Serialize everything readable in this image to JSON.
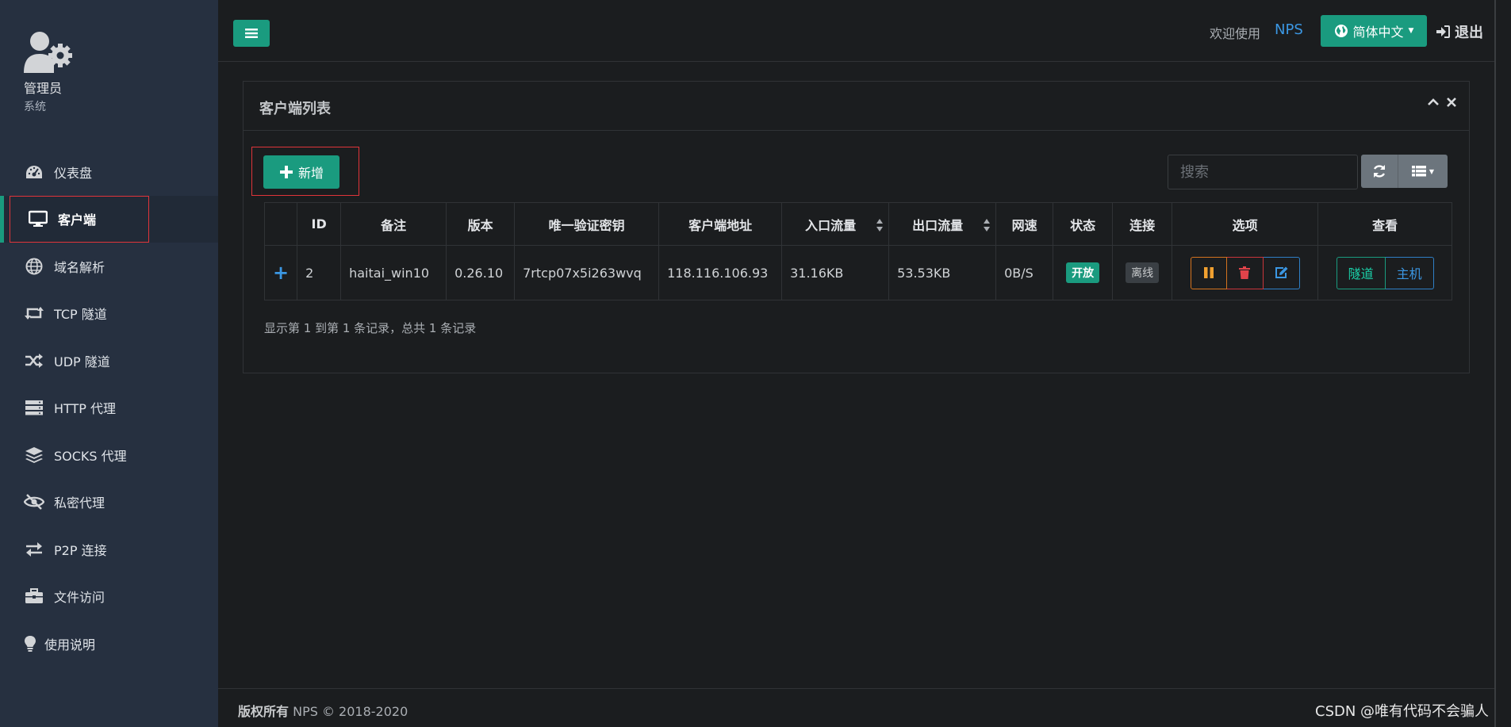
{
  "sidebar": {
    "user_name": "管理员",
    "user_role": "系统",
    "items": [
      {
        "label": "仪表盘",
        "icon": "dashboard-icon"
      },
      {
        "label": "客户端",
        "icon": "monitor-icon",
        "active": true
      },
      {
        "label": "域名解析",
        "icon": "globe-icon"
      },
      {
        "label": "TCP 隧道",
        "icon": "retweet-icon"
      },
      {
        "label": "UDP 隧道",
        "icon": "shuffle-icon"
      },
      {
        "label": "HTTP 代理",
        "icon": "server-icon"
      },
      {
        "label": "SOCKS 代理",
        "icon": "layers-icon"
      },
      {
        "label": "私密代理",
        "icon": "eye-slash-icon"
      },
      {
        "label": "P2P 连接",
        "icon": "exchange-icon"
      },
      {
        "label": "文件访问",
        "icon": "briefcase-icon"
      },
      {
        "label": "使用说明",
        "icon": "lightbulb-icon"
      }
    ]
  },
  "header": {
    "welcome": "欢迎使用",
    "brand": "NPS",
    "language": "简体中文",
    "logout": "退出"
  },
  "panel": {
    "title": "客户端列表",
    "add_label": "新增",
    "search_placeholder": "搜索"
  },
  "table": {
    "columns": [
      "",
      "ID",
      "备注",
      "版本",
      "唯一验证密钥",
      "客户端地址",
      "入口流量",
      "出口流量",
      "网速",
      "状态",
      "连接",
      "选项",
      "查看"
    ],
    "rows": [
      {
        "expand": "+",
        "id": "2",
        "remark": "haitai_win10",
        "version": "0.26.10",
        "key": "7rtcp07x5i263wvq",
        "address": "118.116.106.93",
        "in_flow": "31.16KB",
        "out_flow": "53.53KB",
        "speed": "0B/S",
        "status": "开放",
        "connection": "离线",
        "view_tunnel": "隧道",
        "view_host": "主机"
      }
    ],
    "pagination_info": "显示第 1 到第 1 条记录，总共 1 条记录"
  },
  "footer": {
    "copyright_label": "版权所有",
    "copyright_text": "NPS © 2018-2020",
    "watermark": "CSDN @唯有代码不会骗人"
  },
  "colors": {
    "primary": "#1a9b7f",
    "sidebar_bg": "#263040",
    "page_bg": "#1b1d1f",
    "link": "#3b97e3",
    "danger": "#c9353b",
    "warning": "#d4731f"
  }
}
